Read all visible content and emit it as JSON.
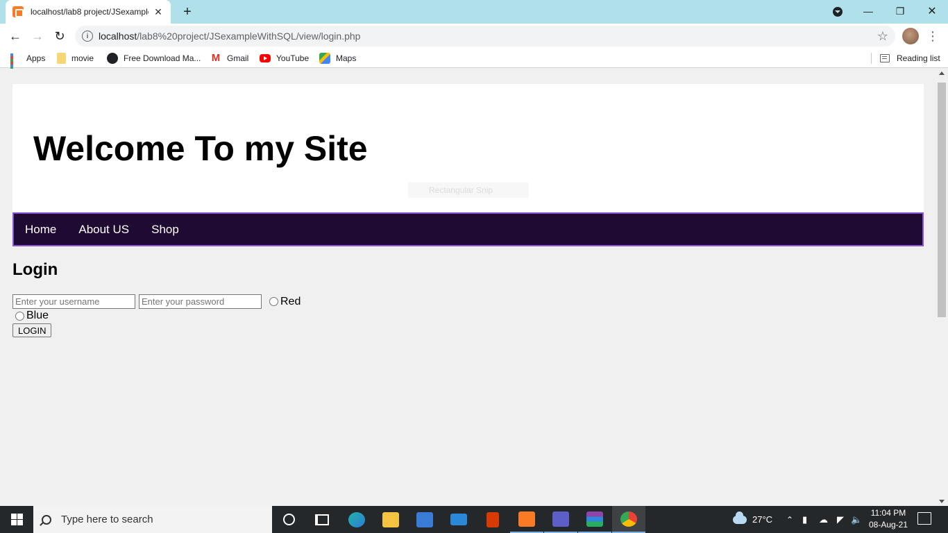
{
  "browser": {
    "tab_title": "localhost/lab8 project/JSexample",
    "tab_close": "✕",
    "new_tab": "+",
    "url_host": "localhost",
    "url_path": "/lab8%20project/JSexampleWithSQL/view/login.php",
    "bookmarks": [
      {
        "label": "Apps",
        "icon": "apps-grid-icon"
      },
      {
        "label": "movie",
        "icon": "folder-icon"
      },
      {
        "label": "Free Download Ma...",
        "icon": "globe-icon"
      },
      {
        "label": "Gmail",
        "icon": "gmail-icon"
      },
      {
        "label": "YouTube",
        "icon": "youtube-icon"
      },
      {
        "label": "Maps",
        "icon": "maps-icon"
      }
    ],
    "reading_list": "Reading list"
  },
  "page": {
    "site_title": "Welcome To my Site",
    "ghost_label": "Rectangular Snip",
    "nav": [
      "Home",
      "About US",
      "Shop"
    ],
    "login_heading": "Login",
    "username_placeholder": "Enter your username",
    "password_placeholder": "Enter your password",
    "radio_options": [
      "Red",
      "Blue"
    ],
    "login_button": "LOGIN"
  },
  "taskbar": {
    "search_placeholder": "Type here to search",
    "weather": "27°C",
    "time": "11:04 PM",
    "date": "08-Aug-21"
  },
  "colors": {
    "titlebar": "#b0e0ea",
    "navbar_bg": "#1f0a33",
    "navbar_border": "#8a54d6",
    "page_bg": "#f0f0f0",
    "taskbar_bg": "#24282b"
  }
}
